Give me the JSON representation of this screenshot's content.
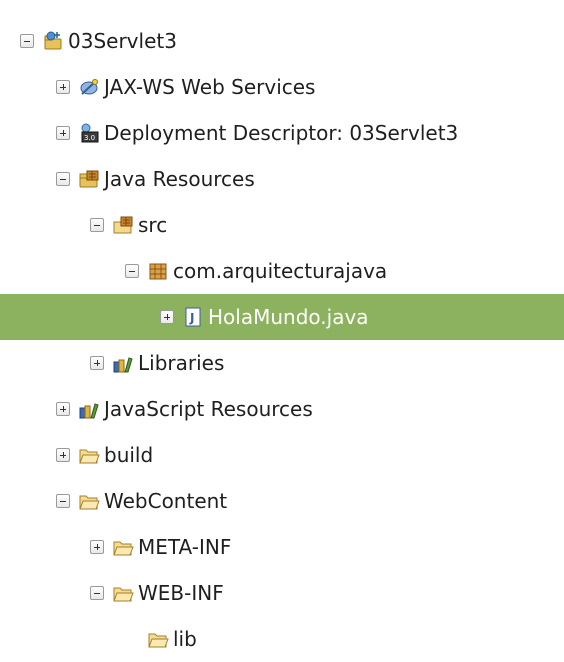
{
  "tree": {
    "rows": [
      {
        "label": "03Servlet3",
        "icon": "web-project-icon",
        "expanded": true
      },
      {
        "label": "JAX-WS Web Services",
        "icon": "web-services-icon",
        "expanded": false
      },
      {
        "label": "Deployment Descriptor: 03Servlet3",
        "icon": "deployment-descriptor-icon",
        "expanded": false
      },
      {
        "label": "Java Resources",
        "icon": "java-resources-icon",
        "expanded": true
      },
      {
        "label": "src",
        "icon": "source-folder-icon",
        "expanded": true
      },
      {
        "label": "com.arquitecturajava",
        "icon": "package-icon",
        "expanded": true
      },
      {
        "label": "HolaMundo.java",
        "icon": "java-file-icon",
        "expanded": false,
        "selected": true
      },
      {
        "label": "Libraries",
        "icon": "libraries-icon",
        "expanded": false
      },
      {
        "label": "JavaScript Resources",
        "icon": "libraries-icon",
        "expanded": false
      },
      {
        "label": "build",
        "icon": "folder-icon",
        "expanded": false
      },
      {
        "label": "WebContent",
        "icon": "folder-icon",
        "expanded": true
      },
      {
        "label": "META-INF",
        "icon": "folder-icon",
        "expanded": false
      },
      {
        "label": "WEB-INF",
        "icon": "folder-icon",
        "expanded": true
      },
      {
        "label": "lib",
        "icon": "folder-icon",
        "expanded": false,
        "no_toggle": true
      }
    ]
  },
  "colors": {
    "selection": "#8db25f",
    "selection_text": "#ffffff",
    "text": "#1f1f1f"
  }
}
